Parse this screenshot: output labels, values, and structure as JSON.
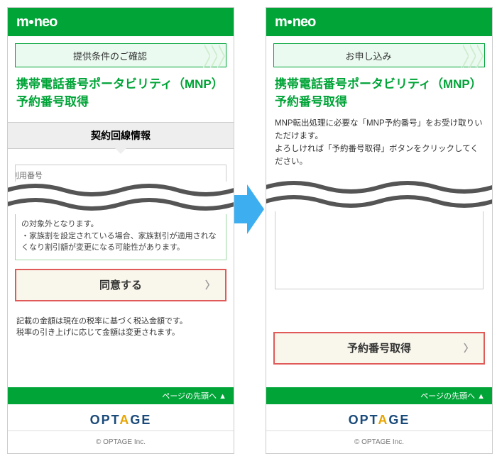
{
  "brand": "mineo",
  "left": {
    "step_label": "提供条件のご確認",
    "title": "携帯電話番号ポータビリティ（MNP）予約番号取得",
    "section_header": "契約回線情報",
    "partial_field_label": "利用番号",
    "note_line1": "の対象外となります。",
    "note_line2": "・家族割を設定されている場合、家族割引が適用されなくなり割引額が変更になる可能性があります。",
    "cta_label": "同意する",
    "footnote_line1": "記載の金額は現在の税率に基づく税込金額です。",
    "footnote_line2": "税率の引き上げに応じて金額は変更されます。"
  },
  "right": {
    "step_label": "お申し込み",
    "title": "携帯電話番号ポータビリティ（MNP）予約番号取得",
    "body_line1": "MNP転出処理に必要な「MNP予約番号」をお受け取りいただけます。",
    "body_line2": "よろしければ「予約番号取得」ボタンをクリックしてください。",
    "cta_label": "予約番号取得"
  },
  "footer": {
    "to_top": "ページの先頭へ ▲",
    "company": "OPTAGE",
    "copyright": "© OPTAGE Inc."
  }
}
